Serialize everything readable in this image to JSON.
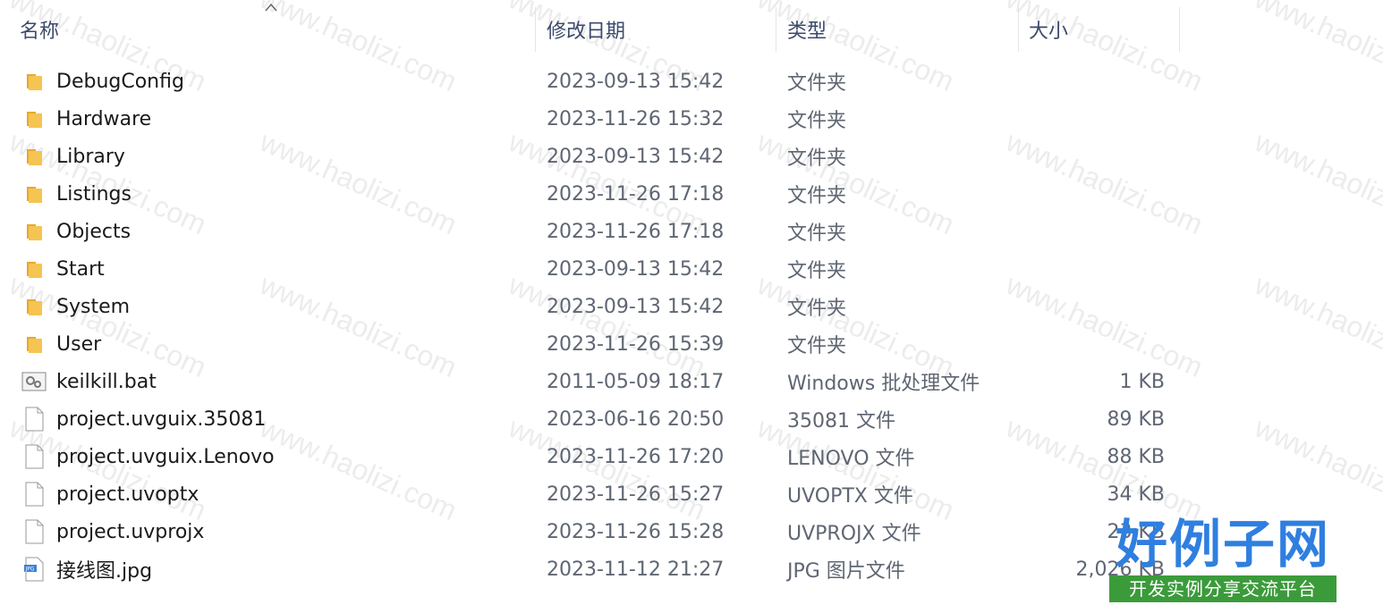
{
  "header": {
    "name_label": "名称",
    "date_label": "修改日期",
    "type_label": "类型",
    "size_label": "大小"
  },
  "files": [
    {
      "name": "DebugConfig",
      "date": "2023-09-13 15:42",
      "type": "文件夹",
      "size": "",
      "icon": "folder-icon"
    },
    {
      "name": "Hardware",
      "date": "2023-11-26 15:32",
      "type": "文件夹",
      "size": "",
      "icon": "folder-icon"
    },
    {
      "name": "Library",
      "date": "2023-09-13 15:42",
      "type": "文件夹",
      "size": "",
      "icon": "folder-icon"
    },
    {
      "name": "Listings",
      "date": "2023-11-26 17:18",
      "type": "文件夹",
      "size": "",
      "icon": "folder-icon"
    },
    {
      "name": "Objects",
      "date": "2023-11-26 17:18",
      "type": "文件夹",
      "size": "",
      "icon": "folder-icon"
    },
    {
      "name": "Start",
      "date": "2023-09-13 15:42",
      "type": "文件夹",
      "size": "",
      "icon": "folder-icon"
    },
    {
      "name": "System",
      "date": "2023-09-13 15:42",
      "type": "文件夹",
      "size": "",
      "icon": "folder-icon"
    },
    {
      "name": "User",
      "date": "2023-11-26 15:39",
      "type": "文件夹",
      "size": "",
      "icon": "folder-icon"
    },
    {
      "name": "keilkill.bat",
      "date": "2011-05-09 18:17",
      "type": "Windows 批处理文件",
      "size": "1 KB",
      "icon": "batch-file-icon"
    },
    {
      "name": "project.uvguix.35081",
      "date": "2023-06-16 20:50",
      "type": "35081 文件",
      "size": "89 KB",
      "icon": "file-icon"
    },
    {
      "name": "project.uvguix.Lenovo",
      "date": "2023-11-26 17:20",
      "type": "LENOVO 文件",
      "size": "88 KB",
      "icon": "file-icon"
    },
    {
      "name": "project.uvoptx",
      "date": "2023-11-26 15:27",
      "type": "UVOPTX 文件",
      "size": "34 KB",
      "icon": "file-icon"
    },
    {
      "name": "project.uvprojx",
      "date": "2023-11-26 15:28",
      "type": "UVPROJX 文件",
      "size": "23 KB",
      "icon": "file-icon"
    },
    {
      "name": "接线图.jpg",
      "date": "2023-11-12 21:27",
      "type": "JPG 图片文件",
      "size": "2,026 KB",
      "icon": "image-file-icon"
    }
  ],
  "watermark": {
    "text": "www.haolizi.com"
  },
  "logo": {
    "main": "好例子网",
    "sub": "开发实例分享交流平台"
  },
  "colors": {
    "folder": "#f5c452",
    "header_text": "#3b4a6b",
    "logo_blue": "#2f7fe0",
    "logo_green": "#3b9b3b"
  }
}
